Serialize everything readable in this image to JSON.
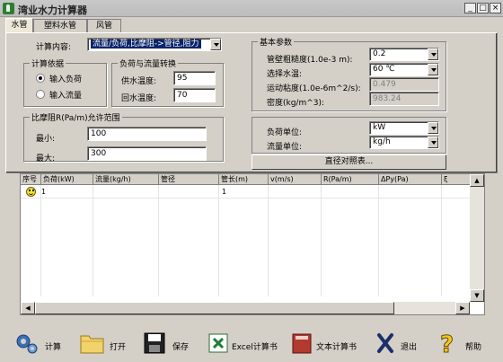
{
  "window": {
    "title": "湾业水力计算器",
    "min": "_",
    "max": "□",
    "close": "×"
  },
  "tabs": [
    {
      "label": "水管"
    },
    {
      "label": "塑料水管"
    },
    {
      "label": "风管"
    }
  ],
  "calc": {
    "label": "计算内容:",
    "value": "流量/负荷,比摩阻->管径,阻力"
  },
  "basis": {
    "title": "计算依据",
    "opt1": "输入负荷",
    "opt2": "输入流量"
  },
  "conv": {
    "title": "负荷与流量转换",
    "supply_label": "供水温度:",
    "supply_value": "95",
    "return_label": "回水温度:",
    "return_value": "70"
  },
  "friction": {
    "title": "比摩阻R(Pa/m)允许范围",
    "min_label": "最小:",
    "min_value": "100",
    "max_label": "最大:",
    "max_value": "300"
  },
  "params": {
    "title": "基本参数",
    "rough_label": "管壁粗糙度(1.0e-3 m):",
    "rough_value": "0.2",
    "temp_label": "选择水温:",
    "temp_value": "60 ℃",
    "visc_label": "运动粘度(1.0e-6m^2/s):",
    "visc_value": "0.479",
    "dens_label": "密度(kg/m^3):",
    "dens_value": "983.24"
  },
  "units": {
    "load_label": "负荷单位:",
    "load_value": "kW",
    "flow_label": "流量单位:",
    "flow_value": "kg/h"
  },
  "compare_button": "直径对照表...",
  "grid": {
    "headers": [
      "序号",
      "负荷(kW)",
      "流量(kg/h)",
      "管径",
      "管长(m)",
      "v(m/s)",
      "R(Pa/m)",
      "ΔPy(Pa)",
      "ξ"
    ],
    "row": {
      "no": "1",
      "length": "1"
    }
  },
  "toolbar": {
    "calc": "计算",
    "open": "打开",
    "save": "保存",
    "excel": "Excel计算书",
    "text": "文本计算书",
    "exit": "退出",
    "help": "帮助"
  }
}
